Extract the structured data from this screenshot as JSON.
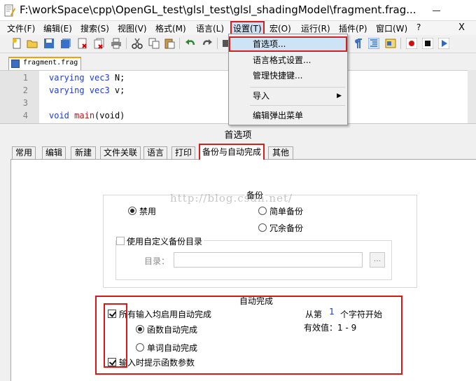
{
  "window": {
    "title": "F:\\workSpace\\cpp\\OpenGL_test\\glsl_test\\glsl_shadingModel\\fragment.frag..."
  },
  "menubar": {
    "items": [
      {
        "label": "文件(F)"
      },
      {
        "label": "编辑(E)"
      },
      {
        "label": "搜索(S)"
      },
      {
        "label": "视图(V)"
      },
      {
        "label": "格式(M)"
      },
      {
        "label": "语言(L)"
      },
      {
        "label": "设置(T)"
      },
      {
        "label": "宏(O)"
      },
      {
        "label": "运行(R)"
      },
      {
        "label": "插件(P)"
      },
      {
        "label": "窗口(W)"
      },
      {
        "label": "?"
      }
    ],
    "close_label": "X"
  },
  "settings_menu": {
    "items": [
      {
        "label": "首选项..."
      },
      {
        "label": "语言格式设置..."
      },
      {
        "label": "管理快捷键..."
      },
      {
        "label": "导入"
      },
      {
        "label": "编辑弹出菜单"
      }
    ],
    "submenu_arrow": "▶"
  },
  "file_tab": {
    "label": "fragment.frag"
  },
  "editor": {
    "lines": [
      {
        "num": "1",
        "kw": "varying vec3",
        "rest": " N;"
      },
      {
        "num": "2",
        "kw": "varying vec3",
        "rest": " v;"
      },
      {
        "num": "3",
        "kw": "",
        "rest": ""
      },
      {
        "num": "4",
        "kw": "void",
        "fn": "main",
        "rest": "(void)"
      }
    ]
  },
  "dialog": {
    "title": "首选项",
    "tabs": [
      {
        "label": "常用"
      },
      {
        "label": "编辑"
      },
      {
        "label": "新建"
      },
      {
        "label": "文件关联"
      },
      {
        "label": "语言"
      },
      {
        "label": "打印"
      },
      {
        "label": "备份与自动完成"
      },
      {
        "label": "其他"
      }
    ],
    "backup": {
      "legend": "备份",
      "option_none": "禁用",
      "option_simple": "简单备份",
      "option_verbose": "冗余备份",
      "selected": "禁用",
      "custom_dir_label": "使用自定义备份目录",
      "custom_dir_checked": false,
      "dir_label": "目录：",
      "dir_value": "",
      "browse_label": "..."
    },
    "autocomplete": {
      "legend": "自动完成",
      "enable_label": "所有输入均启用自动完成",
      "enable_checked": true,
      "func_label": "函数自动完成",
      "word_label": "单词自动完成",
      "selected": "函数自动完成",
      "hint_label": "输入时提示函数参数",
      "hint_checked": true,
      "from_prefix": "从第",
      "from_value": "1",
      "from_suffix": "个字符开始",
      "valid_range": "有效值：1 - 9"
    }
  },
  "watermark": "http://blog.csdn.net/",
  "colors": {
    "highlight_red": "#d02020",
    "keyword_blue": "#2040c0",
    "function_red": "#b01818"
  }
}
